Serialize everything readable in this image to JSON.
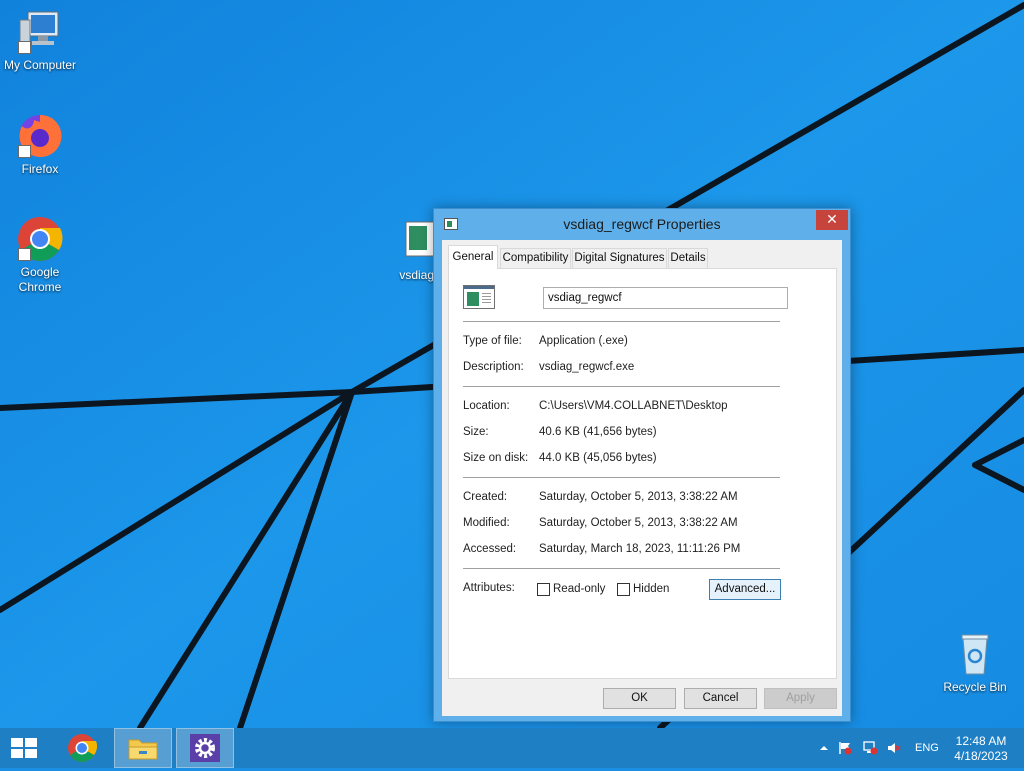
{
  "desktop": {
    "icons": [
      {
        "label": "My Computer"
      },
      {
        "label": "Firefox"
      },
      {
        "label": "Google Chrome"
      },
      {
        "label": "vsdiag_"
      },
      {
        "label": "Recycle Bin"
      }
    ]
  },
  "dialog": {
    "title": "vsdiag_regwcf Properties",
    "close_symbol": "✕",
    "tabs": [
      {
        "label": "General",
        "active": true
      },
      {
        "label": "Compatibility"
      },
      {
        "label": "Digital Signatures"
      },
      {
        "label": "Details"
      }
    ],
    "name_value": "vsdiag_regwcf",
    "properties": [
      {
        "label": "Type of file:",
        "value": "Application (.exe)"
      },
      {
        "label": "Description:",
        "value": "vsdiag_regwcf.exe"
      },
      {
        "label": "Location:",
        "value": "C:\\Users\\VM4.COLLABNET\\Desktop"
      },
      {
        "label": "Size:",
        "value": "40.6 KB (41,656 bytes)"
      },
      {
        "label": "Size on disk:",
        "value": "44.0 KB (45,056 bytes)"
      },
      {
        "label": "Created:",
        "value": "Saturday, October 5, 2013, 3:38:22 AM"
      },
      {
        "label": "Modified:",
        "value": "Saturday, October 5, 2013, 3:38:22 AM"
      },
      {
        "label": "Accessed:",
        "value": "Saturday, March 18, 2023, 11:11:26 PM"
      }
    ],
    "attributes_label": "Attributes:",
    "readonly_label": "Read-only",
    "hidden_label": "Hidden",
    "advanced_label": "Advanced...",
    "ok_label": "OK",
    "cancel_label": "Cancel",
    "apply_label": "Apply"
  },
  "taskbar": {
    "items": [
      "start-icon",
      "chrome-icon",
      "file-explorer-icon",
      "settings-icon"
    ],
    "lang": "ENG",
    "time": "12:48 AM",
    "date": "4/18/2023"
  },
  "colors": {
    "desktop": "#1a8fe3",
    "taskbar": "#1f7fc4",
    "dialog_frame": "#5fb0ea",
    "close": "#c7443d"
  }
}
